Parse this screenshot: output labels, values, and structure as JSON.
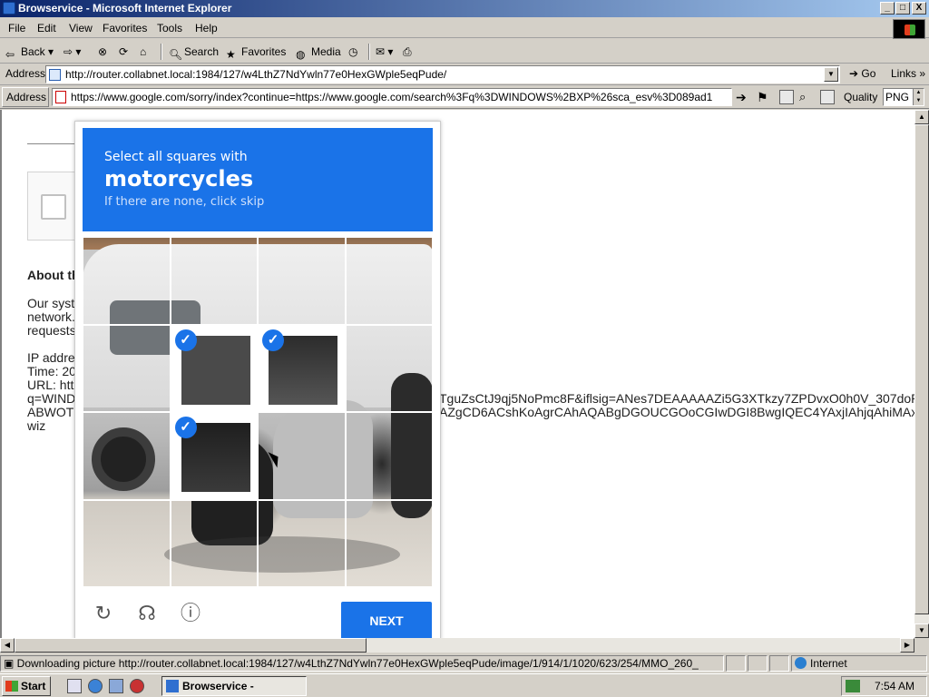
{
  "window": {
    "title": "Browservice - Microsoft Internet Explorer",
    "controls": [
      "_",
      "□",
      "X"
    ]
  },
  "menu": {
    "items": [
      "File",
      "Edit",
      "View",
      "Favorites",
      "Tools",
      "Help"
    ]
  },
  "toolbar": {
    "back": "Back",
    "search": "Search",
    "favorites": "Favorites",
    "media": "Media"
  },
  "addressbar": {
    "label": "Address",
    "url": "http://router.collabnet.local:1984/127/w4LthZ7NdYwln77e0HexGWple5eqPude/",
    "go": "Go",
    "links": "Links"
  },
  "browservice_bar": {
    "label": "Address",
    "url": "https://www.google.com/sorry/index?continue=https://www.google.com/search%3Fq%3DWINDOWS%2BXP%26sca_esv%3D089ad1",
    "quality_label": "Quality",
    "quality_value": "PNG"
  },
  "background_page": {
    "about_heading": "About th",
    "para_lines": [
      "Our syst",
      "network.",
      "requests"
    ],
    "ip_line": "IP addres",
    "time_line": "Time: 20",
    "url_line": "URL: http",
    "q_line": "q=WINDO",
    "abwoti_line": "ABWOTI",
    "wiz_line": "wiz",
    "right_line1": "TguZsCtJ9qj5NoPmc8F&iflsig=ANes7DEAAAAAZi5G3XTkzy7ZPDvxO0h0V_307doRS5of",
    "right_line2": "AZgCD6ACshKoAgrCAhAQABgDGOUCGOoCGIwDGI8BwgIQEC4YAxjIAhjqAhiMAxiPAcIC"
  },
  "captcha": {
    "instruction": "Select all squares with",
    "object": "motorcycles",
    "skip_hint": "If there are none, click skip",
    "next_label": "NEXT",
    "selected_tiles": [
      5,
      6,
      9
    ],
    "icons": [
      "reload-icon",
      "audio-icon",
      "info-icon"
    ]
  },
  "statusbar": {
    "text": "Downloading picture http://router.collabnet.local:1984/127/w4LthZ7NdYwln77e0HexGWple5eqPude/image/1/914/1/1020/623/254/MMO_260_",
    "zone": "Internet"
  },
  "taskbar": {
    "start": "Start",
    "task": "Browservice - Microso...",
    "clock": "7:54 AM"
  }
}
